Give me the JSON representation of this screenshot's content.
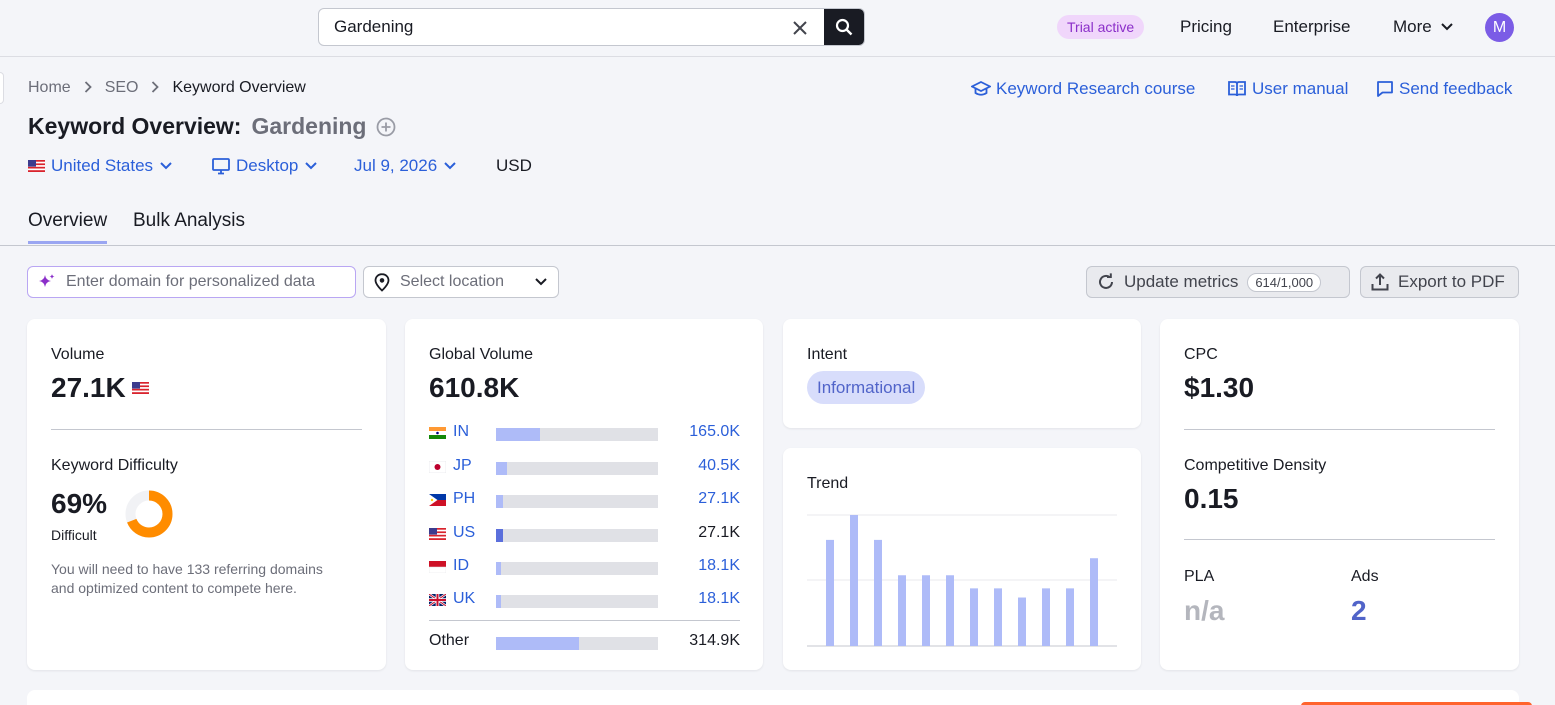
{
  "topbar": {
    "search_value": "Gardening",
    "trial_label": "Trial active",
    "nav": [
      "Pricing",
      "Enterprise",
      "More"
    ],
    "avatar_initial": "M"
  },
  "breadcrumb": [
    "Home",
    "SEO",
    "Keyword Overview"
  ],
  "header_links": {
    "course": "Keyword Research course",
    "manual": "User manual",
    "feedback": "Send feedback"
  },
  "title": {
    "prefix": "Keyword Overview:",
    "keyword": "Gardening"
  },
  "filters": {
    "country": "United States",
    "device": "Desktop",
    "date": "Jul 9, 2026",
    "currency": "USD"
  },
  "tabs": [
    "Overview",
    "Bulk Analysis"
  ],
  "toolbar": {
    "domain_placeholder": "Enter domain for personalized data",
    "location_placeholder": "Select location",
    "update_label": "Update metrics",
    "update_counter": "614/1,000",
    "export_label": "Export to PDF"
  },
  "volume_card": {
    "volume_label": "Volume",
    "volume_value": "27.1K",
    "kd_label": "Keyword Difficulty",
    "kd_value": "69%",
    "kd_percent": 69,
    "kd_level": "Difficult",
    "kd_note_line1": "You will need to have 133 referring domains",
    "kd_note_line2": "and optimized content to compete here.",
    "kd_color": "#ff8c00"
  },
  "global_card": {
    "label": "Global Volume",
    "value": "610.8K",
    "countries": [
      {
        "code": "IN",
        "value": "165.0K",
        "share": 0.27,
        "link": true
      },
      {
        "code": "JP",
        "value": "40.5K",
        "share": 0.066,
        "link": true
      },
      {
        "code": "PH",
        "value": "27.1K",
        "share": 0.044,
        "link": true
      },
      {
        "code": "US",
        "value": "27.1K",
        "share": 0.044,
        "link": false
      },
      {
        "code": "ID",
        "value": "18.1K",
        "share": 0.03,
        "link": true
      },
      {
        "code": "UK",
        "value": "18.1K",
        "share": 0.03,
        "link": true
      }
    ],
    "other_label": "Other",
    "other_value": "314.9K",
    "other_share": 0.515
  },
  "intent_card": {
    "label": "Intent",
    "badge": "Informational"
  },
  "trend_card": {
    "label": "Trend",
    "chart_data": {
      "type": "bar",
      "values": [
        0.81,
        1.0,
        0.81,
        0.54,
        0.54,
        0.54,
        0.44,
        0.44,
        0.37,
        0.44,
        0.44,
        0.67
      ],
      "ylim": [
        0,
        1
      ]
    }
  },
  "cpc_card": {
    "cpc_label": "CPC",
    "cpc_value": "$1.30",
    "cd_label": "Competitive Density",
    "cd_value": "0.15",
    "pla_label": "PLA",
    "pla_value": "n/a",
    "ads_label": "Ads",
    "ads_value": "2"
  }
}
